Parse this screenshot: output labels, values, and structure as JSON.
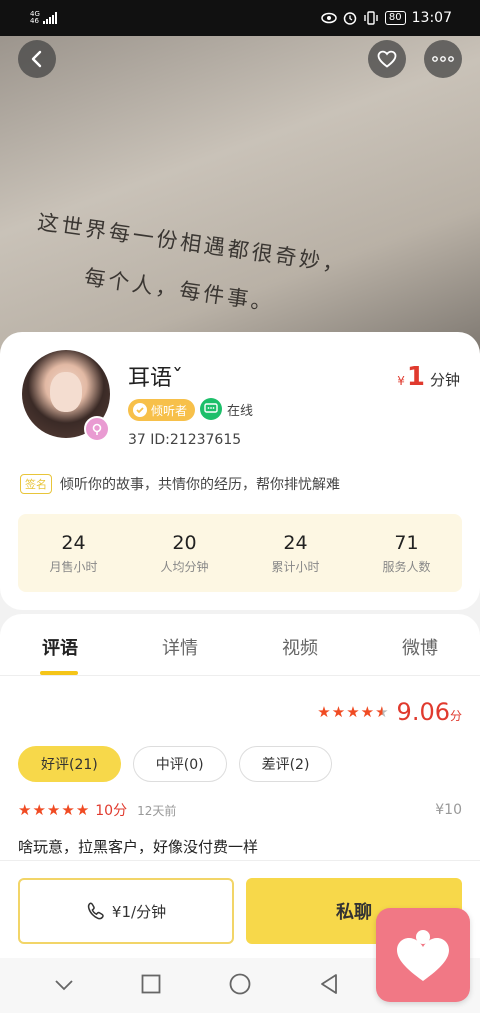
{
  "status_bar": {
    "network": "4G",
    "network2": "46",
    "battery": "80",
    "time": "13:07"
  },
  "hero": {
    "line1": "这世界每一份相遇都很奇妙，",
    "line2": "每个人，每件事。"
  },
  "profile": {
    "name": "耳语ˇ",
    "price_currency": "¥",
    "price_value": "1",
    "price_unit": "分钟",
    "tag_listener": "倾听者",
    "status": "在线",
    "age_id": "37  ID:21237615",
    "sign_label": "签名",
    "signature": "倾听你的故事，共情你的经历，帮你排忧解难"
  },
  "stats": [
    {
      "value": "24",
      "label": "月售小时"
    },
    {
      "value": "20",
      "label": "人均分钟"
    },
    {
      "value": "24",
      "label": "累计小时"
    },
    {
      "value": "71",
      "label": "服务人数"
    }
  ],
  "tabs": [
    {
      "label": "评语",
      "active": true
    },
    {
      "label": "详情",
      "active": false
    },
    {
      "label": "视频",
      "active": false
    },
    {
      "label": "微博",
      "active": false
    }
  ],
  "rating": {
    "stars": 4.5,
    "score": "9.06",
    "unit": "分"
  },
  "filters": [
    {
      "label": "好评(21)",
      "active": true
    },
    {
      "label": "中评(0)",
      "active": false
    },
    {
      "label": "差评(2)",
      "active": false
    }
  ],
  "review": {
    "stars": 5,
    "score": "10分",
    "time": "12天前",
    "price": "¥10",
    "text": "啥玩意，拉黑客户，好像没付费一样"
  },
  "actions": {
    "call": "¥1/分钟",
    "chat": "私聊"
  },
  "colors": {
    "accent": "#f7d84a",
    "price_red": "#e03a2e",
    "star": "#f04b23",
    "online_green": "#1dbf6a"
  }
}
